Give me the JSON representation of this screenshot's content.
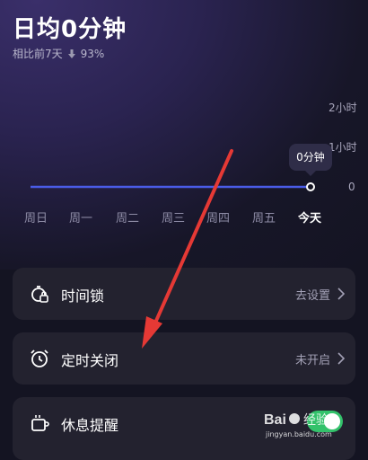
{
  "header": {
    "title": "日均0分钟",
    "compare_label": "相比前7天",
    "compare_value": "93%"
  },
  "chart_data": {
    "type": "line",
    "categories": [
      "周日",
      "周一",
      "周二",
      "周三",
      "周四",
      "周五",
      "今天"
    ],
    "values": [
      0,
      0,
      0,
      0,
      0,
      0,
      0
    ],
    "y_ticks": [
      "2小时",
      "1小时",
      "0"
    ],
    "tooltip": "0分钟"
  },
  "cards": [
    {
      "label": "时间锁",
      "value": "去设置"
    },
    {
      "label": "定时关闭",
      "value": "未开启"
    },
    {
      "label": "休息提醒",
      "value": ""
    }
  ],
  "watermark": {
    "text": "Bai经验",
    "url_text": "jingyan.baidu.com"
  },
  "colors": {
    "accent": "#4a5ce8",
    "arrow": "#e53935",
    "toggle": "#33c26b"
  }
}
